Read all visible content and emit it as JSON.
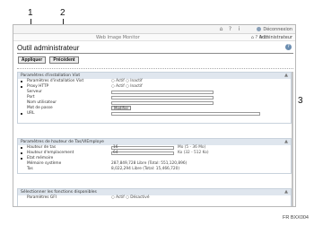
{
  "callouts": {
    "one": "1",
    "two": "2",
    "three": "3"
  },
  "topbar": {
    "logout": "Déconnexion"
  },
  "subbar": {
    "app_title": "Web Image Monitor",
    "icons": "⌂ ? ↻ ☐",
    "admin": "Administrateur"
  },
  "page": {
    "title": "Outil administrateur"
  },
  "buttons": {
    "apply": "Appliquer",
    "previous": "Précédent"
  },
  "section1": {
    "title": "Paramètres d'installation Vixt",
    "rows": [
      {
        "label": "Paramètres d'installation Vixt",
        "value": "○ Actif ○ Inactif"
      },
      {
        "label": "Proxy HTTP",
        "value": "○ Actif ○ Inactif"
      },
      {
        "label": "Serveur",
        "value": ""
      },
      {
        "label": "Port",
        "value": ""
      },
      {
        "label": "Nom utilisateur",
        "value": ""
      },
      {
        "label": "Mot de passe",
        "value": "Modifier"
      },
      {
        "label": "URL",
        "value": ""
      }
    ]
  },
  "section2": {
    "title": "Paramètres de hauteur de Tas/VIEmploye",
    "rows": [
      {
        "label": "Hauteur de tas",
        "value": "16",
        "unit": "Mo (5 - 36 Mo)"
      },
      {
        "label": "Hauteur d'emplacement",
        "value": "64",
        "unit": "Ko (32 - 512 Ko)"
      },
      {
        "label": "Etat mémoire",
        "value": ""
      },
      {
        "label": "Mémoire système",
        "value": "287,849,728  Libre  (Total: 551,120,896)"
      },
      {
        "label": "Tas",
        "value": "8,022,294  Libre  (Total: 15,466,720)"
      }
    ]
  },
  "section3": {
    "title": "Sélectionner les fonctions disponibles",
    "rows": [
      {
        "label": "Paramètres GFI",
        "value": "○ Actif ○ Désactivé"
      }
    ]
  },
  "footer": {
    "code": "FR BXX004"
  }
}
